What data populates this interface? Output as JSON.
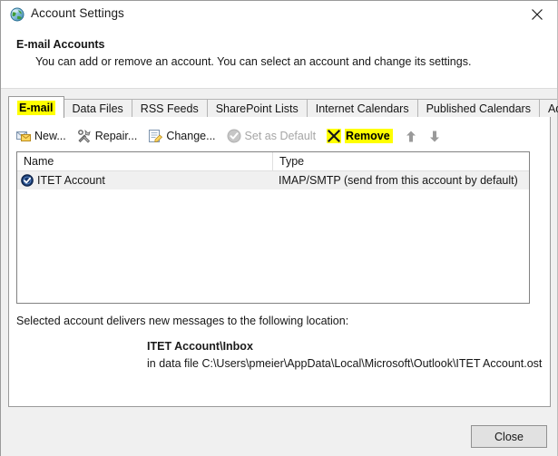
{
  "window": {
    "title": "Account Settings",
    "icon": "outlook-globe-icon",
    "close_icon": "close-icon"
  },
  "header": {
    "title": "E-mail Accounts",
    "description": "You can add or remove an account. You can select an account and change its settings."
  },
  "tabs": [
    {
      "label": "E-mail",
      "selected": true,
      "highlighted": true
    },
    {
      "label": "Data Files",
      "selected": false,
      "highlighted": false
    },
    {
      "label": "RSS Feeds",
      "selected": false,
      "highlighted": false
    },
    {
      "label": "SharePoint Lists",
      "selected": false,
      "highlighted": false
    },
    {
      "label": "Internet Calendars",
      "selected": false,
      "highlighted": false
    },
    {
      "label": "Published Calendars",
      "selected": false,
      "highlighted": false
    },
    {
      "label": "Address Books",
      "selected": false,
      "highlighted": false
    }
  ],
  "toolbar": {
    "new_label": "New...",
    "new_icon": "new-mail-icon",
    "repair_label": "Repair...",
    "repair_icon": "repair-tools-icon",
    "change_label": "Change...",
    "change_icon": "change-account-icon",
    "set_default_label": "Set as Default",
    "set_default_icon": "check-circle-icon",
    "set_default_disabled": true,
    "remove_label": "Remove",
    "remove_icon": "remove-x-icon",
    "remove_highlighted": true,
    "move_up_icon": "arrow-up-icon",
    "move_down_icon": "arrow-down-icon"
  },
  "accounts_list": {
    "columns": [
      "Name",
      "Type"
    ],
    "rows": [
      {
        "name": "ITET Account",
        "type": "IMAP/SMTP (send from this account by default)",
        "icon": "default-account-check-icon",
        "selected": true
      }
    ]
  },
  "delivery": {
    "label": "Selected account delivers new messages to the following location:",
    "target": "ITET Account\\Inbox",
    "path": "in data file C:\\Users\\pmeier\\AppData\\Local\\Microsoft\\Outlook\\ITET Account.ost"
  },
  "footer": {
    "close_label": "Close"
  },
  "colors": {
    "highlight": "#ffff00",
    "dialog_bg": "#f0f0f0",
    "panel_bg": "#ffffff",
    "text": "#161616",
    "disabled_text": "#a6a6a6",
    "remove_x": "#1a1a1a",
    "account_icon": "#102a54"
  }
}
